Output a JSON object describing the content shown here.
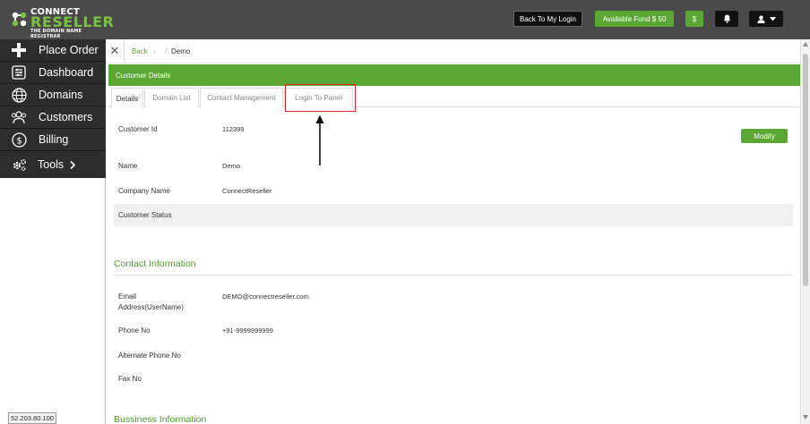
{
  "brand": {
    "line1": "CONNECT",
    "line2": "RESELLER",
    "tagline": "THE DOMAIN NAME REGISTRAR",
    "green": "#5aa833"
  },
  "topbar": {
    "back_to_login": "Back To My Login",
    "available_fund": "Available Fund  $ 50",
    "dollar_label": "$",
    "bell_icon": "bell-icon",
    "user_icon": "user-icon"
  },
  "sidebar": {
    "items": [
      {
        "label": "Place Order",
        "icon": "plus-icon"
      },
      {
        "label": "Dashboard",
        "icon": "dashboard-icon"
      },
      {
        "label": "Domains",
        "icon": "globe-icon"
      },
      {
        "label": "Customers",
        "icon": "users-icon"
      },
      {
        "label": "Billing",
        "icon": "dollar-circle-icon"
      },
      {
        "label": "Tools",
        "icon": "gears-icon"
      }
    ],
    "ip": "52.203.80.100"
  },
  "breadcrumb": {
    "back": "Back",
    "sep1": "›",
    "sep2": "/",
    "current": "Demo"
  },
  "panel": {
    "title": "Customer Details",
    "tabs": [
      "Details",
      "Domain List",
      "Contact Management",
      "Login To Panel"
    ],
    "active_tab": "Details"
  },
  "customer": {
    "id_label": "Customer Id",
    "id_value": "112399",
    "modify_label": "Modify",
    "name_label": "Name",
    "name_value": "Demo",
    "company_label": "Company Name",
    "company_value": "ConnectReseller",
    "status_label": "Customer Status"
  },
  "contact": {
    "title": "Contact Information",
    "email_label_1": "Email",
    "email_label_2": "Address(UserName)",
    "email_value": "DEMO@connectreseller.com",
    "phone_label": "Phone No",
    "phone_value": "+91-9999999999",
    "alt_phone_label": "Alternate Phone No",
    "fax_label": "Fax No"
  },
  "business": {
    "title": "Bussiness Information"
  }
}
